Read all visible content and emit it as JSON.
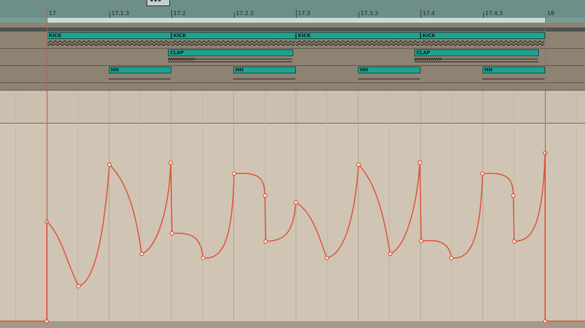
{
  "ruler": {
    "position_box": "▪▪▪",
    "markers": [
      {
        "label": "17",
        "major": true
      },
      {
        "label": "17.1.3",
        "major": false
      },
      {
        "label": "17.2",
        "major": true
      },
      {
        "label": "17.2.3",
        "major": false
      },
      {
        "label": "17.3",
        "major": true
      },
      {
        "label": "17.3.3",
        "major": false
      },
      {
        "label": "17.4",
        "major": true
      },
      {
        "label": "17.4.3",
        "major": false
      },
      {
        "label": "18",
        "major": true
      }
    ]
  },
  "clips": {
    "kick": [
      {
        "label": "KICK"
      },
      {
        "label": "KICK"
      },
      {
        "label": "KICK"
      },
      {
        "label": "KICK"
      }
    ],
    "clap": [
      {
        "label": "CLAP"
      },
      {
        "label": "CLAP"
      }
    ],
    "hh": [
      {
        "label": "HH"
      },
      {
        "label": "HH"
      },
      {
        "label": "HH"
      },
      {
        "label": "HH"
      }
    ]
  },
  "colors": {
    "clip": "#1fa38f",
    "automation": "#e0533a",
    "ruler": "#6e8e8a",
    "loop": "#c6ddd6"
  }
}
